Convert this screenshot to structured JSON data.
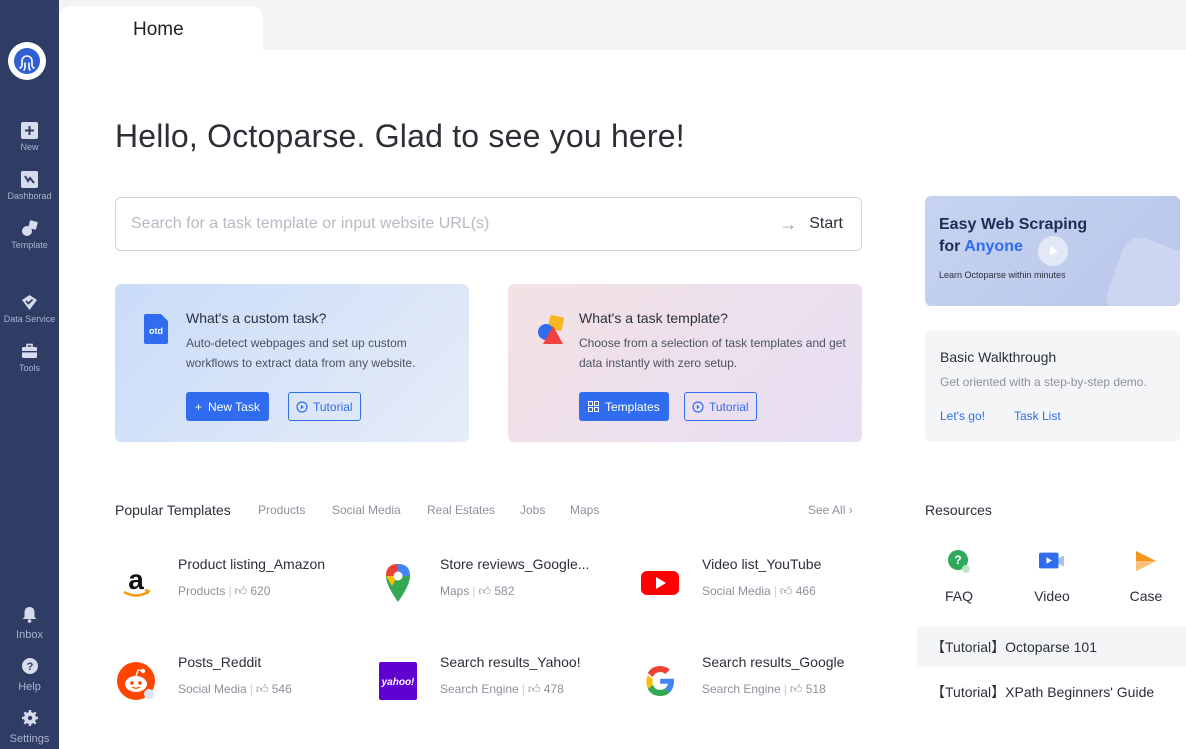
{
  "sidebar": {
    "items": [
      {
        "label": "New",
        "icon": "plus-square-icon"
      },
      {
        "label": "Dashborad",
        "icon": "dashboard-icon"
      },
      {
        "label": "Template",
        "icon": "template-icon"
      },
      {
        "label": "Data Service",
        "icon": "data-service-icon"
      },
      {
        "label": "Tools",
        "icon": "toolbox-icon"
      }
    ],
    "bottom": [
      {
        "label": "Inbox",
        "icon": "bell-icon"
      },
      {
        "label": "Help",
        "icon": "help-icon"
      },
      {
        "label": "Settings",
        "icon": "gear-icon"
      }
    ]
  },
  "tab": {
    "label": "Home"
  },
  "greeting": "Hello, Octoparse. Glad to see you here!",
  "search": {
    "placeholder": "Search for a task template or input website URL(s)",
    "value": "",
    "button": "Start"
  },
  "cards": {
    "custom": {
      "title": "What's a custom task?",
      "desc": "Auto-detect webpages and set up custom workflows to extract data from any website.",
      "primary": "New Task",
      "secondary": "Tutorial",
      "icon_text": "otd"
    },
    "template": {
      "title": "What's a task template?",
      "desc": "Choose from a selection of task templates and get data instantly with zero setup.",
      "primary": "Templates",
      "secondary": "Tutorial"
    }
  },
  "promo": {
    "line1": "Easy Web Scraping",
    "line2_prefix": "for ",
    "line2_highlight": "Anyone",
    "sub": "Learn Octoparse within minutes"
  },
  "walkthrough": {
    "title": "Basic Walkthrough",
    "desc": "Get oriented with a step-by-step demo.",
    "link1": "Let's go!",
    "link2": "Task List"
  },
  "popular": {
    "title": "Popular Templates",
    "categories": [
      "Products",
      "Social Media",
      "Real Estates",
      "Jobs",
      "Maps"
    ],
    "see_all": "See All ›",
    "templates": [
      {
        "name": "Product listing_Amazon",
        "category": "Products",
        "likes": "620",
        "logo": "amazon-logo"
      },
      {
        "name": "Store reviews_Google...",
        "category": "Maps",
        "likes": "582",
        "logo": "google-maps-logo"
      },
      {
        "name": "Video list_YouTube",
        "category": "Social Media",
        "likes": "466",
        "logo": "youtube-logo"
      },
      {
        "name": "Posts_Reddit",
        "category": "Social Media",
        "likes": "546",
        "logo": "reddit-logo"
      },
      {
        "name": "Search results_Yahoo!",
        "category": "Search Engine",
        "likes": "478",
        "logo": "yahoo-logo",
        "logo_text": "yahoo!"
      },
      {
        "name": "Search results_Google",
        "category": "Search Engine",
        "likes": "518",
        "logo": "google-logo"
      }
    ]
  },
  "resources": {
    "title": "Resources",
    "items": [
      {
        "label": "FAQ",
        "icon": "faq-icon"
      },
      {
        "label": "Video",
        "icon": "video-icon"
      },
      {
        "label": "Case",
        "icon": "case-icon"
      }
    ],
    "links": [
      "【Tutorial】Octoparse 101",
      "【Tutorial】XPath Beginners' Guide"
    ]
  },
  "colors": {
    "sidebar": "#2f3c64",
    "accent": "#2f6cf0",
    "promo_bg": "#c6d3f0"
  }
}
